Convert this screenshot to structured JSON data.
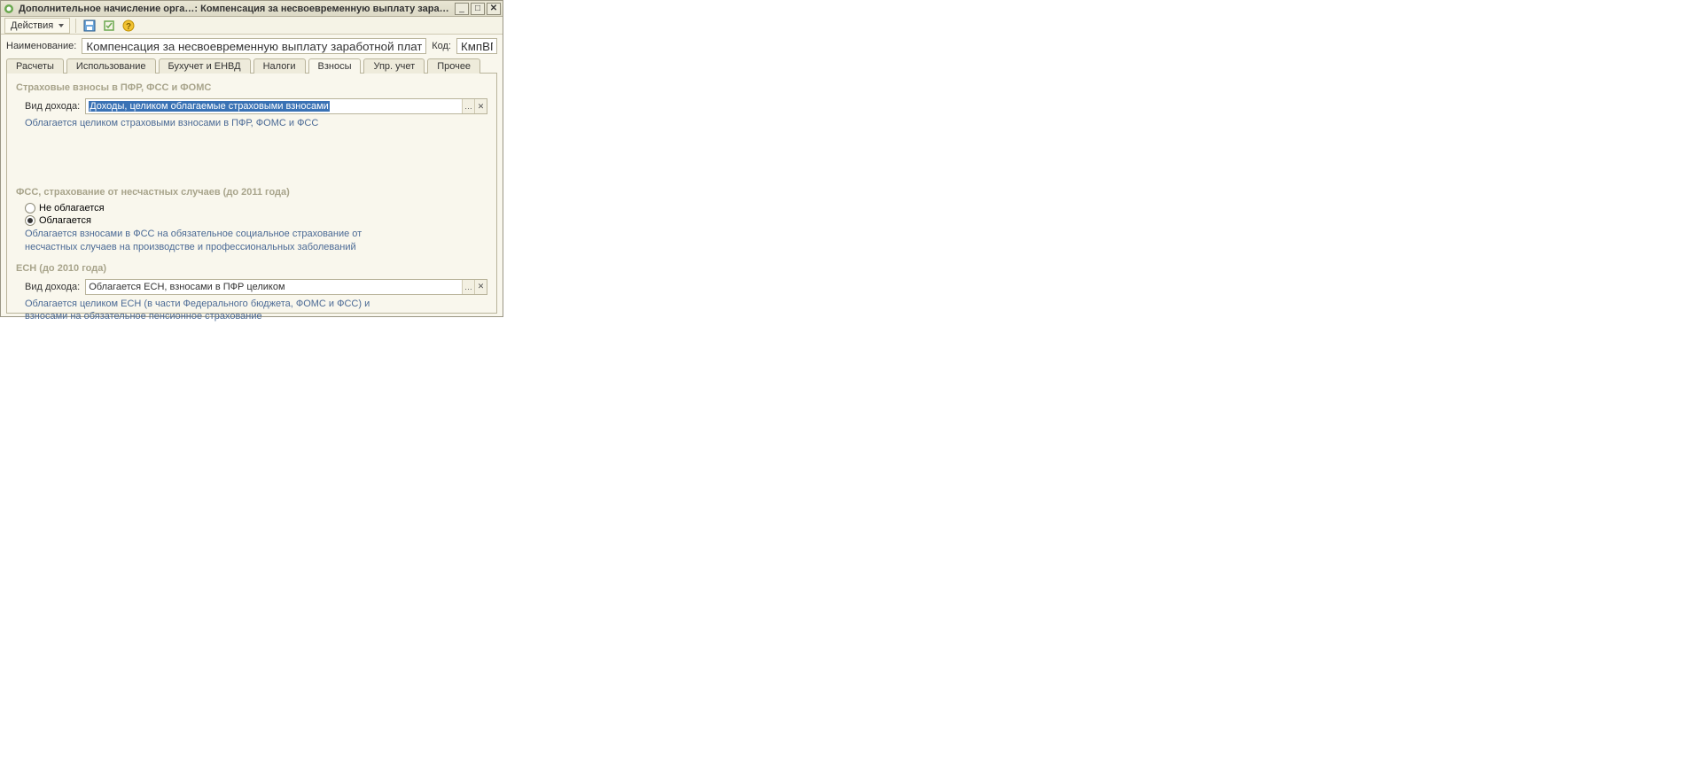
{
  "window": {
    "title": "Дополнительное начисление орга…: Компенсация за несвоевременную выплату заработной платы"
  },
  "toolbar": {
    "actions_label": "Действия"
  },
  "form": {
    "name_label": "Наименование:",
    "name_value": "Компенсация за несвоевременную выплату заработной платы",
    "code_label": "Код:",
    "code_value": "КмпВП"
  },
  "tabs": [
    {
      "id": "raschety",
      "label": "Расчеты"
    },
    {
      "id": "ispolzovanie",
      "label": "Использование"
    },
    {
      "id": "buh",
      "label": "Бухучет и ЕНВД"
    },
    {
      "id": "nalogi",
      "label": "Налоги"
    },
    {
      "id": "vznosy",
      "label": "Взносы",
      "active": true
    },
    {
      "id": "upr",
      "label": "Упр. учет"
    },
    {
      "id": "prochee",
      "label": "Прочее"
    }
  ],
  "section1": {
    "title": "Страховые взносы в ПФР, ФСС и ФОМС",
    "field_label": "Вид дохода:",
    "field_value": "Доходы, целиком облагаемые страховыми взносами",
    "hint": "Облагается целиком страховыми взносами в ПФР, ФОМС и ФСС"
  },
  "section2": {
    "title": "ФСС, страхование от несчастных случаев (до 2011 года)",
    "radio1": "Не облагается",
    "radio2": "Облагается",
    "hint": "Облагается взносами в ФСС на обязательное социальное страхование от несчастных случаев на производстве и профессиональных заболеваний"
  },
  "section3": {
    "title": "ЕСН (до 2010 года)",
    "field_label": "Вид дохода:",
    "field_value": "Облагается ЕСН, взносами в ПФР целиком",
    "hint": "Облагается целиком ЕСН (в части Федерального бюджета, ФОМС и ФСС) и взносами на обязательное пенсионное страхование"
  },
  "icons": {
    "app": "app-icon",
    "save": "save-icon",
    "refresh": "refresh-icon",
    "help": "help-icon",
    "minimize": "_",
    "maximize": "□",
    "close": "✕",
    "ellipsis": "…",
    "clear": "✕"
  }
}
